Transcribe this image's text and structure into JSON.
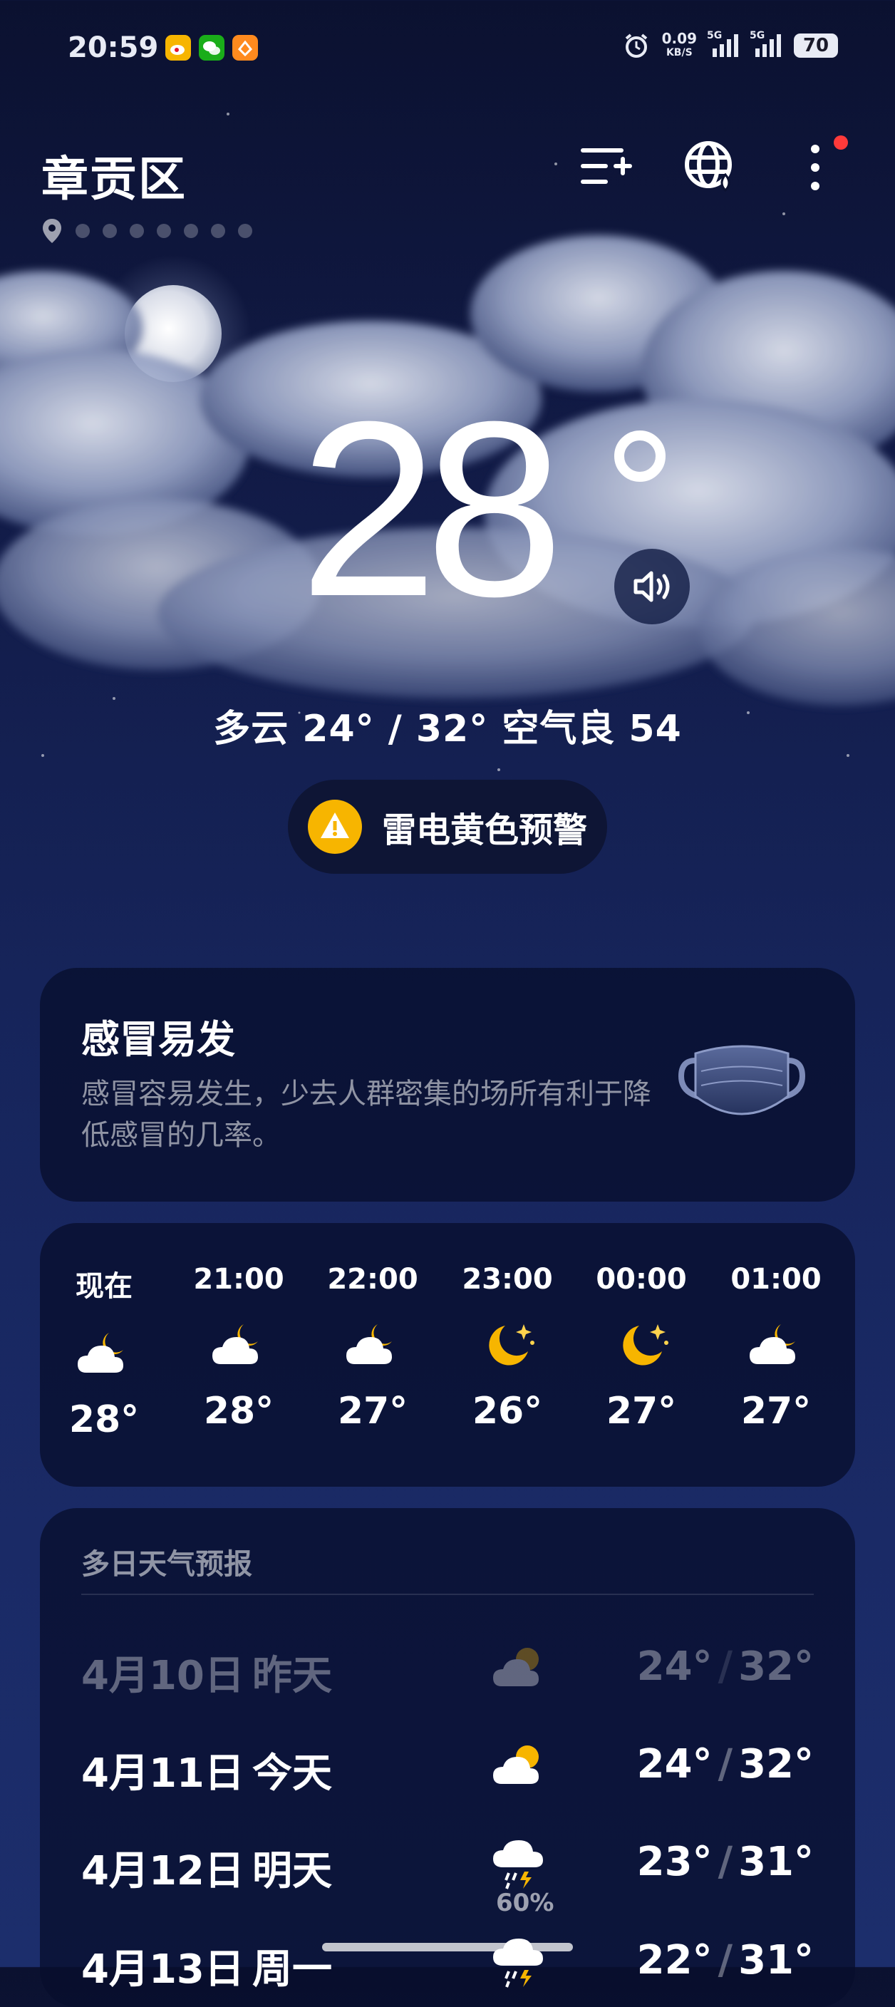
{
  "status_bar": {
    "time": "20:59",
    "net_speed": "0.09",
    "net_unit": "KB/S",
    "sim1_label": "5G",
    "sim2_label": "5G",
    "battery": "70"
  },
  "header": {
    "city": "章贡区",
    "location_page_count": 7
  },
  "current": {
    "temperature": "28",
    "summary": "多云  24° / 32°  空气良 54",
    "alert_label": "雷电黄色预警"
  },
  "tip_card": {
    "title": "感冒易发",
    "description": "感冒容易发生，少去人群密集的场所有利于降低感冒的几率。"
  },
  "hourly": [
    {
      "label": "现在",
      "icon": "cloudy-moon-icon",
      "temp": "28°"
    },
    {
      "label": "21:00",
      "icon": "cloudy-moon-icon",
      "temp": "28°"
    },
    {
      "label": "22:00",
      "icon": "cloudy-moon-icon",
      "temp": "27°"
    },
    {
      "label": "23:00",
      "icon": "clear-night-icon",
      "temp": "26°"
    },
    {
      "label": "00:00",
      "icon": "clear-night-icon",
      "temp": "27°"
    },
    {
      "label": "01:00",
      "icon": "cloudy-moon-icon",
      "temp": "27°"
    }
  ],
  "forecast": {
    "title": "多日天气预报",
    "days": [
      {
        "date": "4月10日",
        "day": "昨天",
        "icon": "partly-cloudy-icon",
        "low": "24°",
        "high": "32°",
        "precip": ""
      },
      {
        "date": "4月11日",
        "day": "今天",
        "icon": "partly-cloudy-icon",
        "low": "24°",
        "high": "32°",
        "precip": ""
      },
      {
        "date": "4月12日",
        "day": "明天",
        "icon": "thunderstorm-icon",
        "low": "23°",
        "high": "31°",
        "precip": "60%"
      },
      {
        "date": "4月13日",
        "day": "周一",
        "icon": "thunderstorm-icon",
        "low": "22°",
        "high": "31°",
        "precip": ""
      }
    ]
  },
  "colors": {
    "accent_sun": "#f7b500",
    "alert_yellow": "#f7b500",
    "notification_red": "#ff3a3a"
  }
}
